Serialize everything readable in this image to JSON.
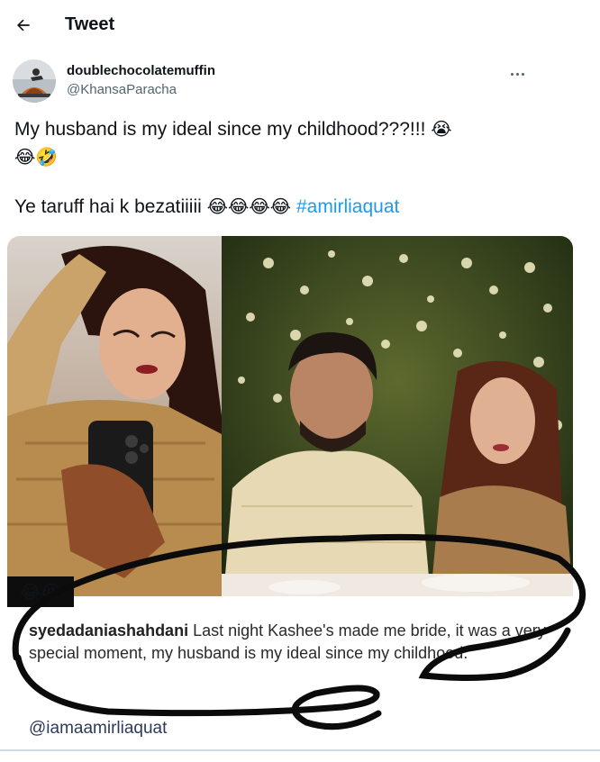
{
  "header": {
    "title": "Tweet",
    "back_icon": "arrow-left-icon"
  },
  "author": {
    "display_name": "doublechocolatemuffin",
    "handle": "@KhansaParacha",
    "more_icon": "more-horizontal-icon"
  },
  "tweet": {
    "line1_text": "My husband is my ideal since my childhood???!!! ",
    "line1_emoji_a": "😭",
    "line1_emoji_b": "😂🤣",
    "line2_text": "Ye taruff hai k bezatiiiii ",
    "line2_emojis": "😂😂😂😂",
    "hashtag": "#amirliaquat"
  },
  "media": {
    "overlay_emojis": "😂😭",
    "caption_username": "syedadaniashahdani",
    "caption_text": " Last night Kashee's made me bride, it was a very special moment, my husband is my ideal since my childhood.",
    "mention": "@iamaamirliaquat"
  },
  "colors": {
    "link": "#1d9bf0",
    "secondary_text": "#536471",
    "primary_text": "#0f1419"
  }
}
